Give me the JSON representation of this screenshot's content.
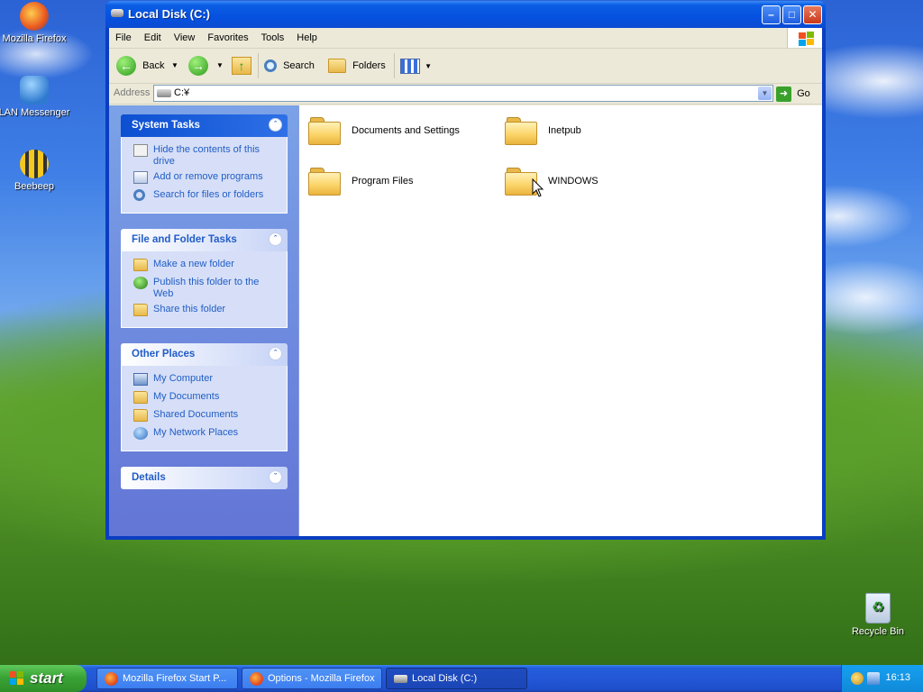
{
  "desktop": {
    "icons": [
      {
        "label": "Mozilla Firefox"
      },
      {
        "label": "LAN Messenger"
      },
      {
        "label": "Beebeep"
      },
      {
        "label": "Recycle Bin"
      }
    ]
  },
  "window": {
    "title": "Local Disk (C:)",
    "menu": [
      "File",
      "Edit",
      "View",
      "Favorites",
      "Tools",
      "Help"
    ],
    "toolbar": {
      "back": "Back",
      "search": "Search",
      "folders": "Folders"
    },
    "address": {
      "label": "Address",
      "value": "C:¥",
      "go": "Go"
    },
    "tasks": {
      "system": {
        "title": "System Tasks",
        "items": [
          "Hide the contents of this drive",
          "Add or remove programs",
          "Search for files or folders"
        ]
      },
      "file_folder": {
        "title": "File and Folder Tasks",
        "items": [
          "Make a new folder",
          "Publish this folder to the Web",
          "Share this folder"
        ]
      },
      "other": {
        "title": "Other Places",
        "items": [
          "My Computer",
          "My Documents",
          "Shared Documents",
          "My Network Places"
        ]
      },
      "details": {
        "title": "Details"
      }
    },
    "folders": [
      "Documents and Settings",
      "Inetpub",
      "Program Files",
      "WINDOWS"
    ]
  },
  "taskbar": {
    "start": "start",
    "tasks": [
      "Mozilla Firefox Start P...",
      "Options - Mozilla Firefox",
      "Local Disk (C:)"
    ],
    "time": "16:13"
  },
  "colors": {
    "xp_blue": "#0a4ad2",
    "task_link": "#215dc6",
    "start_green": "#3aa336"
  }
}
